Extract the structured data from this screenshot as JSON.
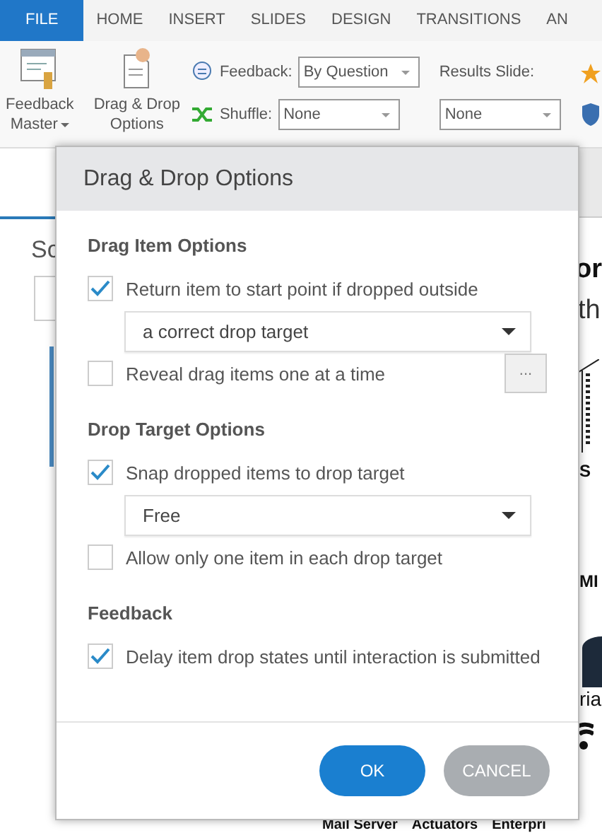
{
  "ribbon": {
    "tabs": [
      {
        "label": "FILE",
        "selected": true
      },
      {
        "label": "HOME",
        "selected": false
      },
      {
        "label": "INSERT",
        "selected": false
      },
      {
        "label": "SLIDES",
        "selected": false
      },
      {
        "label": "DESIGN",
        "selected": false
      },
      {
        "label": "TRANSITIONS",
        "selected": false
      },
      {
        "label": "AN",
        "selected": false
      }
    ],
    "feedback_master": {
      "label_1": "Feedback",
      "label_2": "Master"
    },
    "drag_drop": {
      "label_1": "Drag & Drop",
      "label_2": "Options"
    },
    "feedback": {
      "label": "Feedback:",
      "value": "By Question"
    },
    "shuffle": {
      "label": "Shuffle:",
      "value": "None"
    },
    "results_slide": {
      "label": "Results Slide:",
      "value": "None"
    }
  },
  "left_panel": {
    "heading": "Sc"
  },
  "slide": {
    "title": "or",
    "subtitle": "th",
    "labels": [
      "S",
      "MI",
      "ria"
    ],
    "captions": [
      "Mail Server",
      "Actuators",
      "Enterpri"
    ]
  },
  "dialog": {
    "title": "Drag & Drop Options",
    "sections": [
      {
        "heading": "Drag Item Options",
        "items": [
          {
            "kind": "checkbox",
            "label": "Return item to start point if dropped outside",
            "checked": true
          },
          {
            "kind": "select",
            "value": "a correct drop target"
          },
          {
            "kind": "checkbox",
            "label": "Reveal drag items one at a time",
            "checked": false,
            "more": "..."
          }
        ]
      },
      {
        "heading": "Drop Target Options",
        "items": [
          {
            "kind": "checkbox",
            "label": "Snap dropped items to drop target",
            "checked": true
          },
          {
            "kind": "select",
            "value": "Free"
          },
          {
            "kind": "checkbox",
            "label": "Allow only one item in each drop target",
            "checked": false
          }
        ]
      },
      {
        "heading": "Feedback",
        "items": [
          {
            "kind": "checkbox",
            "label": "Delay item drop states until interaction is submitted",
            "checked": true
          }
        ]
      }
    ],
    "buttons": [
      {
        "label": "OK",
        "primary": true
      },
      {
        "label": "CANCEL",
        "primary": false
      }
    ]
  }
}
